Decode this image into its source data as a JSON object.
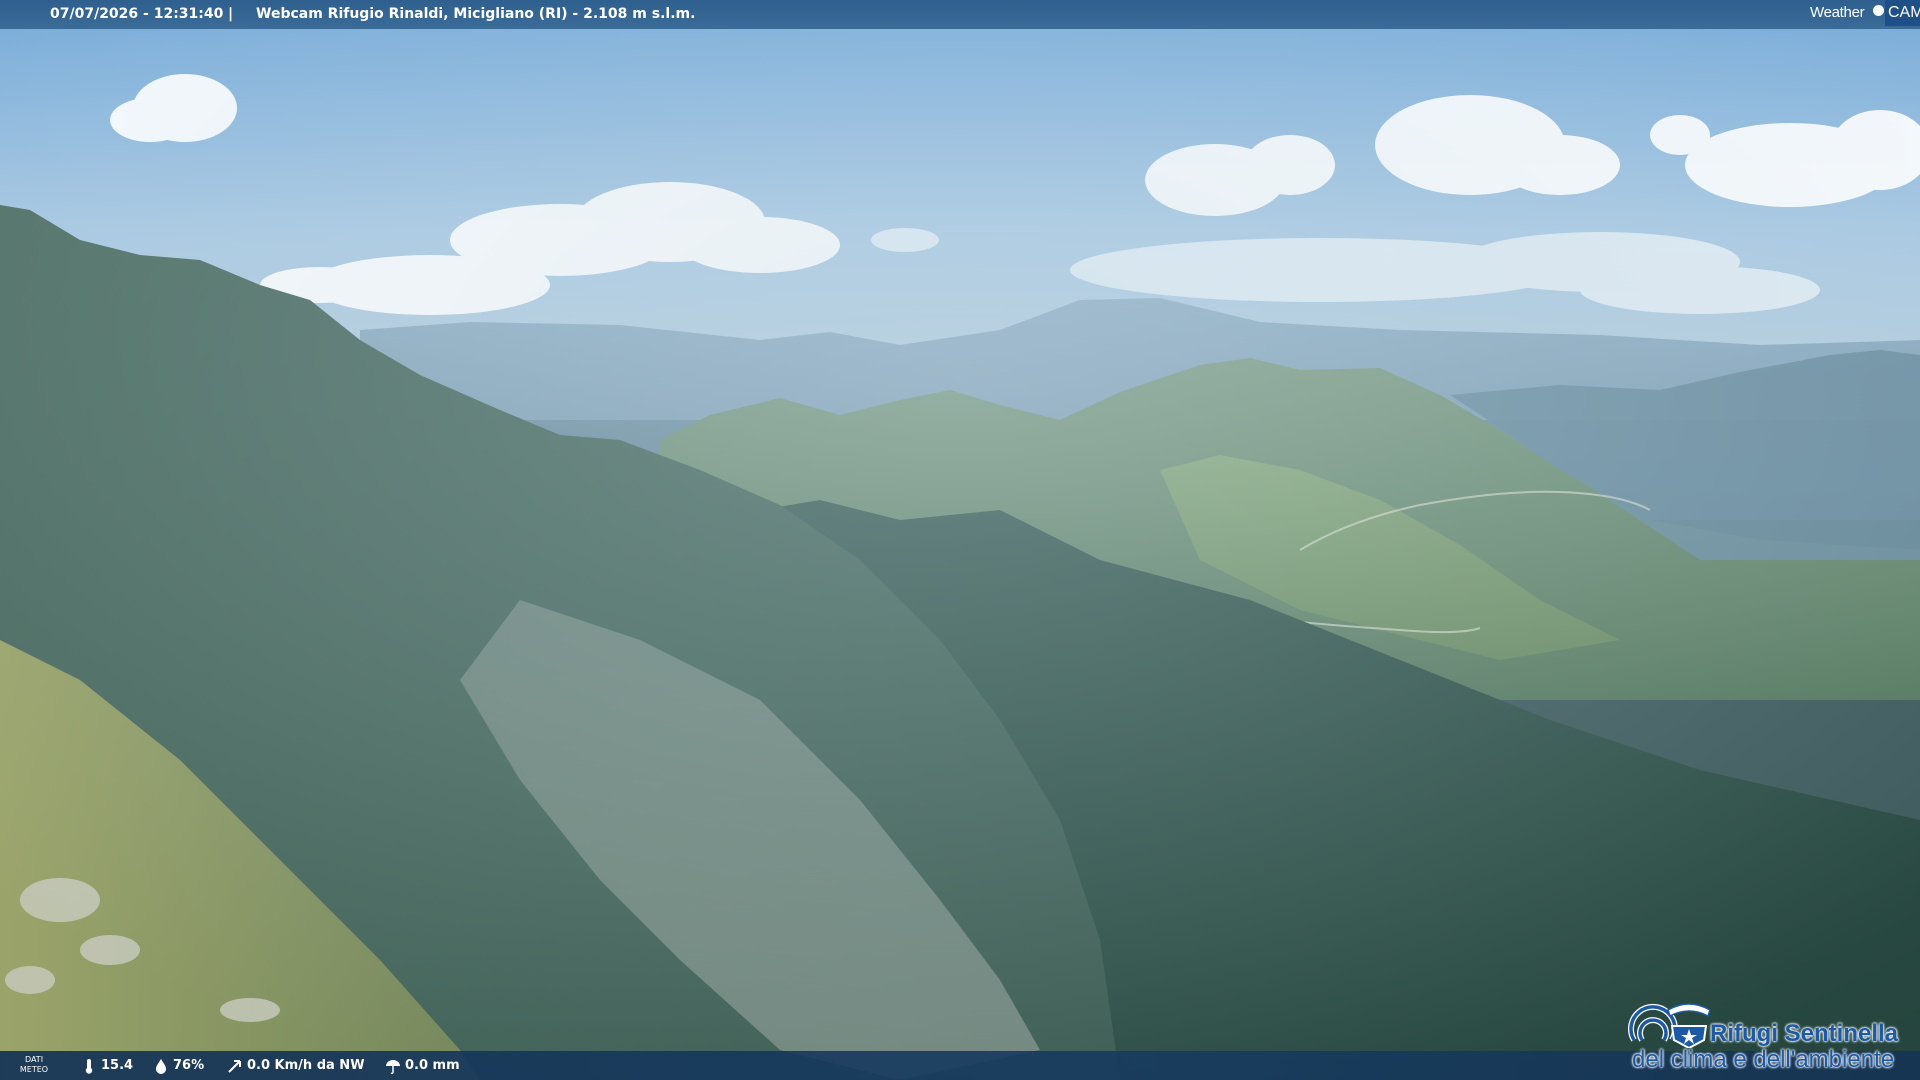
{
  "header": {
    "timestamp": "07/07/2026 - 12:31:40",
    "separator": "|",
    "title": "Webcam Rifugio Rinaldi, Micigliano (RI) - 2.108 m s.l.m."
  },
  "brand": {
    "weather": "Weather",
    "cam": "CAM"
  },
  "weather": {
    "label_line1": "DATI",
    "label_line2": "METEO",
    "temperature": "15.4",
    "humidity": "76%",
    "wind": "0.0 Km/h da NW",
    "rain": "0.0 mm"
  },
  "partner_logo": {
    "line1": "Rifugi Sentinella",
    "line2": "del clima e dell'ambiente"
  },
  "colors": {
    "bar_top": "#2f5f8e",
    "bar_bottom": "#163a60",
    "logo_blue": "#1d5aa6",
    "sky": "#7fb0dc"
  }
}
